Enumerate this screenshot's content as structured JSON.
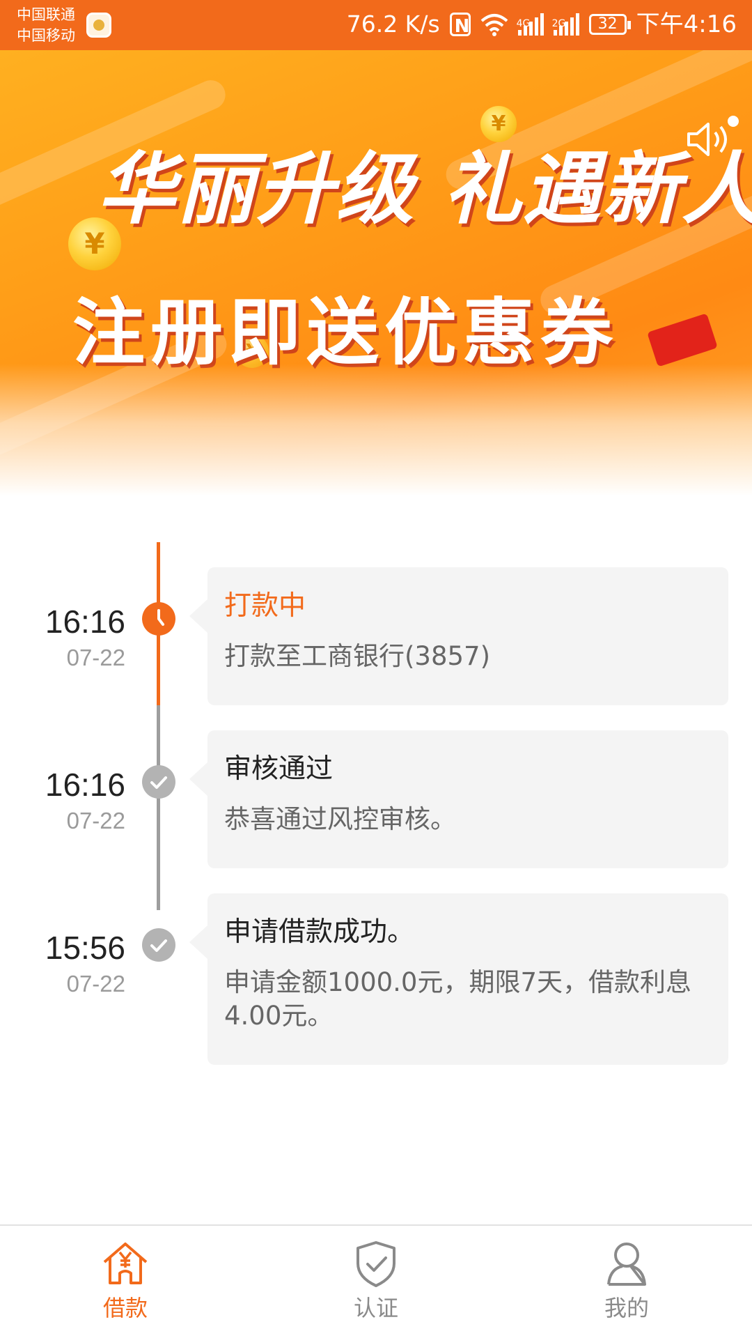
{
  "status_bar": {
    "carrier_1": "中国联通",
    "carrier_2": "中国移动",
    "net_speed": "76.2 K/s",
    "signal_1_tag": "4G",
    "signal_2_tag": "2G",
    "battery": "32",
    "time": "下午4:16"
  },
  "banner": {
    "headline": "华丽升级 礼遇新人",
    "subheadline": "注册即送优惠券",
    "carousel_pages": 2,
    "active_page": 2
  },
  "timeline": [
    {
      "time": "16:16",
      "date": "07-22",
      "title": "打款中",
      "description": "打款至工商银行(3857)",
      "state": "active"
    },
    {
      "time": "16:16",
      "date": "07-22",
      "title": "审核通过",
      "description": "恭喜通过风控审核。",
      "state": "done"
    },
    {
      "time": "15:56",
      "date": "07-22",
      "title": "申请借款成功。",
      "description": "申请金额1000.0元，期限7天，借款利息4.00元。",
      "state": "done"
    }
  ],
  "bottom_nav": {
    "items": [
      {
        "label": "借款",
        "icon": "home-yen-icon",
        "active": true
      },
      {
        "label": "认证",
        "icon": "shield-check-icon",
        "active": false
      },
      {
        "label": "我的",
        "icon": "user-icon",
        "active": false
      }
    ]
  },
  "colors": {
    "accent": "#f26a1b",
    "inactive": "#8a8a8a",
    "card_bg": "#f4f4f4"
  }
}
